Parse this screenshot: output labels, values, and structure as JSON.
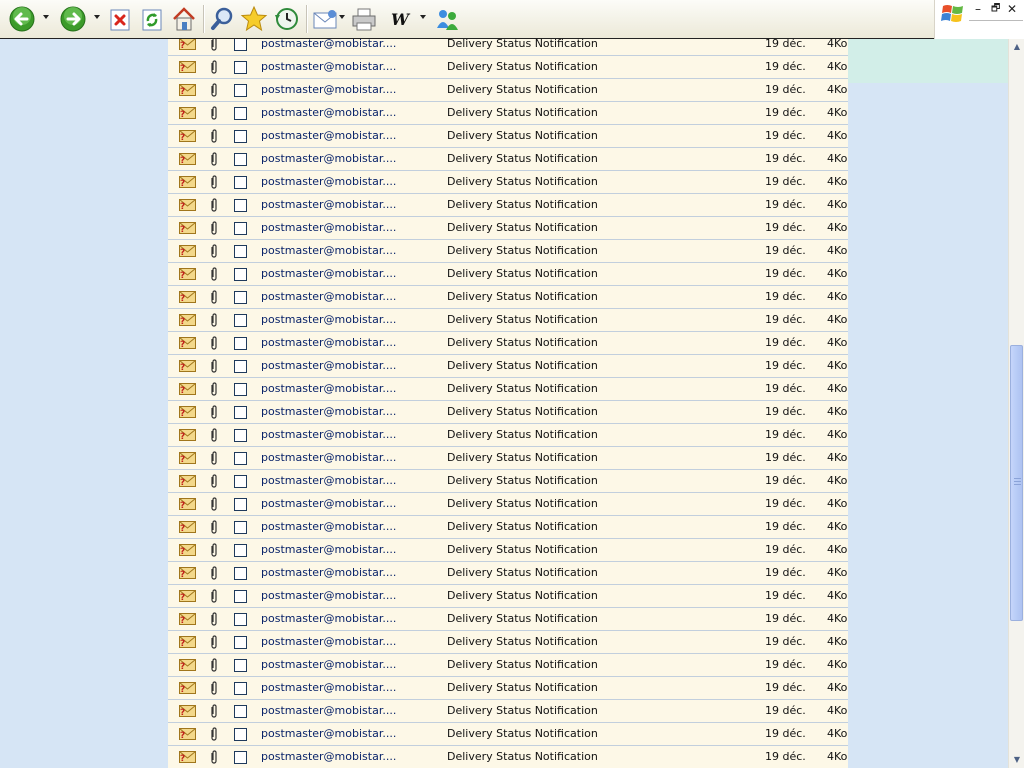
{
  "toolbar": {
    "buttons": [
      {
        "name": "back-button",
        "icon": "back-arrow-icon"
      },
      {
        "name": "forward-button",
        "icon": "forward-arrow-icon"
      },
      {
        "name": "stop-button",
        "icon": "stop-icon"
      },
      {
        "name": "refresh-button",
        "icon": "refresh-icon"
      },
      {
        "name": "home-button",
        "icon": "home-icon"
      },
      {
        "name": "search-button",
        "icon": "search-icon"
      },
      {
        "name": "favorites-button",
        "icon": "star-icon"
      },
      {
        "name": "history-button",
        "icon": "history-icon"
      },
      {
        "name": "mail-button",
        "icon": "mail-icon"
      },
      {
        "name": "print-button",
        "icon": "printer-icon"
      },
      {
        "name": "edit-button",
        "icon": "word-icon"
      },
      {
        "name": "messenger-button",
        "icon": "messenger-icon"
      }
    ],
    "edit_glyph": "W"
  },
  "window_controls": {
    "minimize": "–",
    "restore": "🗗",
    "close": "✕"
  },
  "colors": {
    "page_bg": "#d6e5f5",
    "row_bg": "#fdf8e7",
    "row_border": "#c2cfdd",
    "sender_text": "#0a246a",
    "teal_strip": "#d2eee8"
  },
  "messages": [
    {
      "from": "postmaster@mobistar....",
      "subject": "Delivery Status Notification",
      "date": "19 déc.",
      "size": "4Ko",
      "checked": false
    },
    {
      "from": "postmaster@mobistar....",
      "subject": "Delivery Status Notification",
      "date": "19 déc.",
      "size": "4Ko",
      "checked": false
    },
    {
      "from": "postmaster@mobistar....",
      "subject": "Delivery Status Notification",
      "date": "19 déc.",
      "size": "4Ko",
      "checked": false
    },
    {
      "from": "postmaster@mobistar....",
      "subject": "Delivery Status Notification",
      "date": "19 déc.",
      "size": "4Ko",
      "checked": false
    },
    {
      "from": "postmaster@mobistar....",
      "subject": "Delivery Status Notification",
      "date": "19 déc.",
      "size": "4Ko",
      "checked": false
    },
    {
      "from": "postmaster@mobistar....",
      "subject": "Delivery Status Notification",
      "date": "19 déc.",
      "size": "4Ko",
      "checked": false
    },
    {
      "from": "postmaster@mobistar....",
      "subject": "Delivery Status Notification",
      "date": "19 déc.",
      "size": "4Ko",
      "checked": false
    },
    {
      "from": "postmaster@mobistar....",
      "subject": "Delivery Status Notification",
      "date": "19 déc.",
      "size": "4Ko",
      "checked": false
    },
    {
      "from": "postmaster@mobistar....",
      "subject": "Delivery Status Notification",
      "date": "19 déc.",
      "size": "4Ko",
      "checked": false
    },
    {
      "from": "postmaster@mobistar....",
      "subject": "Delivery Status Notification",
      "date": "19 déc.",
      "size": "4Ko",
      "checked": false
    },
    {
      "from": "postmaster@mobistar....",
      "subject": "Delivery Status Notification",
      "date": "19 déc.",
      "size": "4Ko",
      "checked": false
    },
    {
      "from": "postmaster@mobistar....",
      "subject": "Delivery Status Notification",
      "date": "19 déc.",
      "size": "4Ko",
      "checked": false
    },
    {
      "from": "postmaster@mobistar....",
      "subject": "Delivery Status Notification",
      "date": "19 déc.",
      "size": "4Ko",
      "checked": false
    },
    {
      "from": "postmaster@mobistar....",
      "subject": "Delivery Status Notification",
      "date": "19 déc.",
      "size": "4Ko",
      "checked": false
    },
    {
      "from": "postmaster@mobistar....",
      "subject": "Delivery Status Notification",
      "date": "19 déc.",
      "size": "4Ko",
      "checked": false
    },
    {
      "from": "postmaster@mobistar....",
      "subject": "Delivery Status Notification",
      "date": "19 déc.",
      "size": "4Ko",
      "checked": false
    },
    {
      "from": "postmaster@mobistar....",
      "subject": "Delivery Status Notification",
      "date": "19 déc.",
      "size": "4Ko",
      "checked": false
    },
    {
      "from": "postmaster@mobistar....",
      "subject": "Delivery Status Notification",
      "date": "19 déc.",
      "size": "4Ko",
      "checked": false
    },
    {
      "from": "postmaster@mobistar....",
      "subject": "Delivery Status Notification",
      "date": "19 déc.",
      "size": "4Ko",
      "checked": false
    },
    {
      "from": "postmaster@mobistar....",
      "subject": "Delivery Status Notification",
      "date": "19 déc.",
      "size": "4Ko",
      "checked": false
    },
    {
      "from": "postmaster@mobistar....",
      "subject": "Delivery Status Notification",
      "date": "19 déc.",
      "size": "4Ko",
      "checked": false
    },
    {
      "from": "postmaster@mobistar....",
      "subject": "Delivery Status Notification",
      "date": "19 déc.",
      "size": "4Ko",
      "checked": false
    },
    {
      "from": "postmaster@mobistar....",
      "subject": "Delivery Status Notification",
      "date": "19 déc.",
      "size": "4Ko",
      "checked": false
    },
    {
      "from": "postmaster@mobistar....",
      "subject": "Delivery Status Notification",
      "date": "19 déc.",
      "size": "4Ko",
      "checked": false
    },
    {
      "from": "postmaster@mobistar....",
      "subject": "Delivery Status Notification",
      "date": "19 déc.",
      "size": "4Ko",
      "checked": false
    },
    {
      "from": "postmaster@mobistar....",
      "subject": "Delivery Status Notification",
      "date": "19 déc.",
      "size": "4Ko",
      "checked": false
    },
    {
      "from": "postmaster@mobistar....",
      "subject": "Delivery Status Notification",
      "date": "19 déc.",
      "size": "4Ko",
      "checked": false
    },
    {
      "from": "postmaster@mobistar....",
      "subject": "Delivery Status Notification",
      "date": "19 déc.",
      "size": "4Ko",
      "checked": false
    },
    {
      "from": "postmaster@mobistar....",
      "subject": "Delivery Status Notification",
      "date": "19 déc.",
      "size": "4Ko",
      "checked": false
    },
    {
      "from": "postmaster@mobistar....",
      "subject": "Delivery Status Notification",
      "date": "19 déc.",
      "size": "4Ko",
      "checked": false
    },
    {
      "from": "postmaster@mobistar....",
      "subject": "Delivery Status Notification",
      "date": "19 déc.",
      "size": "4Ko",
      "checked": false
    },
    {
      "from": "postmaster@mobistar....",
      "subject": "Delivery Status Notification",
      "date": "19 déc.",
      "size": "4Ko",
      "checked": false
    },
    {
      "from": "postmaster@mobistar....",
      "subject": "Delivery Status Notification",
      "date": "19 déc.",
      "size": "4Ko",
      "checked": false
    }
  ],
  "scrollbar": {
    "position": 0.55,
    "visible_fraction": 0.4
  }
}
